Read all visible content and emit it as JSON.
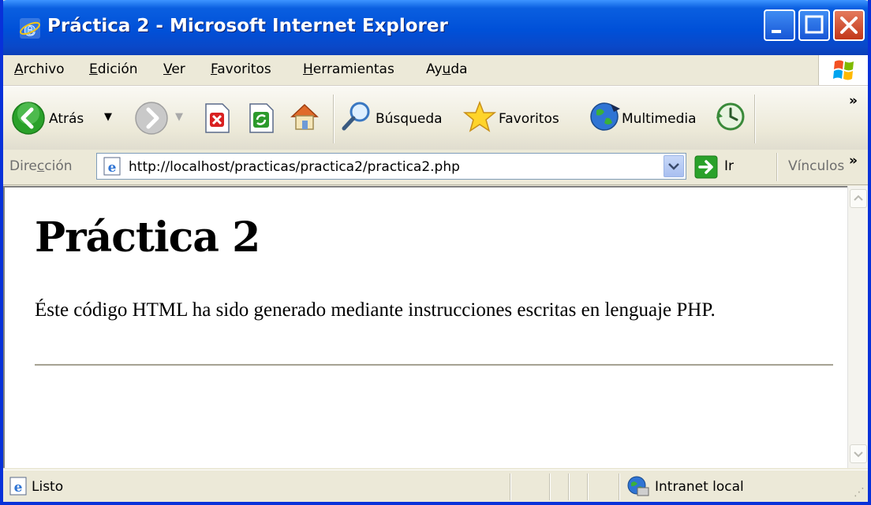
{
  "window": {
    "title": "Práctica 2 - Microsoft Internet Explorer"
  },
  "menubar": {
    "items": [
      {
        "label": "Archivo",
        "accel": "A",
        "rest": "rchivo"
      },
      {
        "label": "Edición",
        "accel": "E",
        "rest": "dición"
      },
      {
        "label": "Ver",
        "accel": "V",
        "rest": "er"
      },
      {
        "label": "Favoritos",
        "accel": "F",
        "rest": "avoritos"
      },
      {
        "label": "Herramientas",
        "accel": "H",
        "rest": "erramientas"
      },
      {
        "label": "Ayuda",
        "pre": "Ay",
        "accel": "u",
        "rest": "da"
      }
    ]
  },
  "toolbar": {
    "back_label": "Atrás",
    "search_label": "Búsqueda",
    "favorites_label": "Favoritos",
    "media_label": "Multimedia",
    "chevron": "»"
  },
  "address": {
    "label_pre": "Dire",
    "label_accel": "c",
    "label_post": "ción",
    "url": "http://localhost/practicas/practica2/practica2.php",
    "go_label": "Ir",
    "links_label": "Vínculos",
    "chevron": "»"
  },
  "page": {
    "heading": "Práctica 2",
    "paragraph": "Éste código HTML ha sido generado mediante instrucciones escritas en lenguaje PHP."
  },
  "status": {
    "text": "Listo",
    "zone": "Intranet local"
  },
  "colors": {
    "titlebar": "#0050d8",
    "chrome": "#ece9d8",
    "close_button": "#c2371a",
    "back_arrow": "#2aa12a",
    "go_arrow": "#2aa12a"
  }
}
